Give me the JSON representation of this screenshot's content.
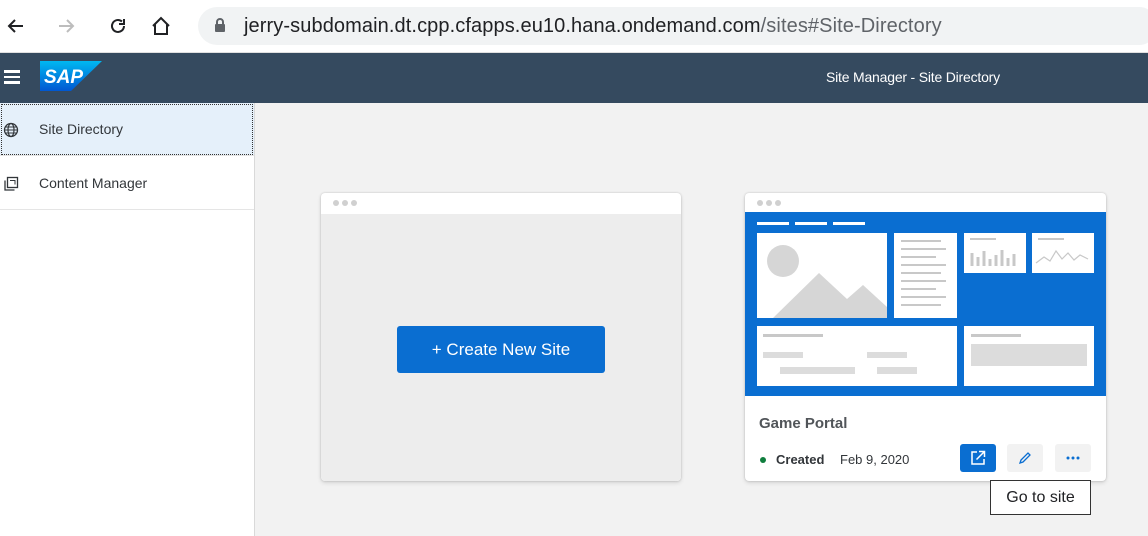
{
  "browser": {
    "url_host": "jerry-subdomain.dt.cpp.cfapps.eu10.hana.ondemand.com",
    "url_path": "/sites#Site-Directory"
  },
  "shell": {
    "logo_text": "SAP",
    "title": "Site Manager - Site Directory"
  },
  "sidebar": {
    "items": [
      {
        "label": "Site Directory",
        "icon": "globe-icon",
        "selected": true
      },
      {
        "label": "Content Manager",
        "icon": "copy-icon",
        "selected": false
      }
    ]
  },
  "main": {
    "create_button_label": "+ Create New Site",
    "site_card": {
      "name": "Game Portal",
      "status": "Created",
      "date": "Feb 9, 2020",
      "actions": [
        "go-to-site-icon",
        "edit-icon",
        "more-icon"
      ]
    },
    "tooltip": "Go to site"
  },
  "colors": {
    "shell": "#354a5f",
    "accent": "#0a6ed1",
    "status_positive": "#107e3e"
  }
}
